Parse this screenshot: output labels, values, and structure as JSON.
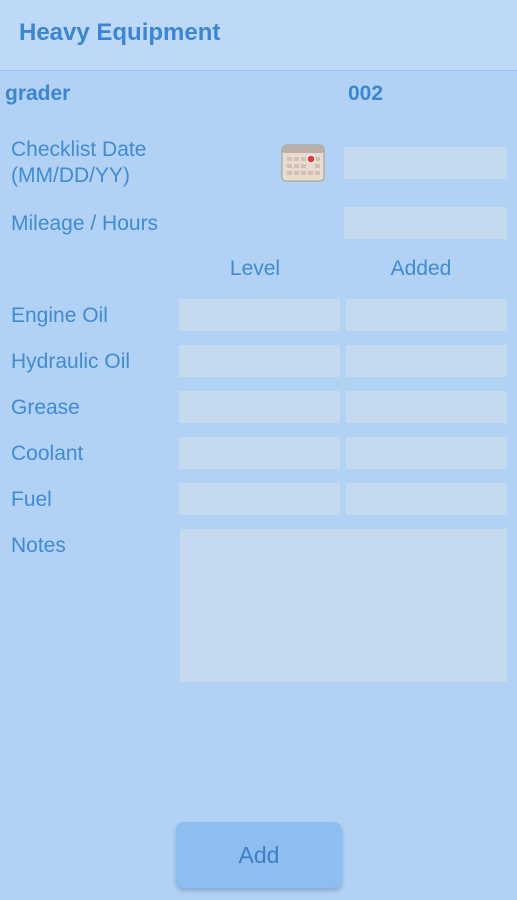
{
  "header": {
    "title": "Heavy Equipment"
  },
  "equipment": {
    "name": "grader",
    "id": "002"
  },
  "form": {
    "checklist_date_label_line1": "Checklist Date",
    "checklist_date_label_line2": "(MM/DD/YY)",
    "checklist_date_value": "",
    "mileage_label": "Mileage / Hours",
    "mileage_value": "",
    "col_level": "Level",
    "col_added": "Added",
    "rows": [
      {
        "label": "Engine Oil",
        "level": "",
        "added": ""
      },
      {
        "label": "Hydraulic Oil",
        "level": "",
        "added": ""
      },
      {
        "label": "Grease",
        "level": "",
        "added": ""
      },
      {
        "label": "Coolant",
        "level": "",
        "added": ""
      },
      {
        "label": "Fuel",
        "level": "",
        "added": ""
      }
    ],
    "notes_label": "Notes",
    "notes_value": ""
  },
  "icons": {
    "date_picker": "calendar-icon"
  },
  "add_button": {
    "label": "Add"
  },
  "colors": {
    "background": "#b1d2f4",
    "accent": "#3b86d4",
    "field": "#c6daef",
    "button": "#8ebdf0"
  }
}
